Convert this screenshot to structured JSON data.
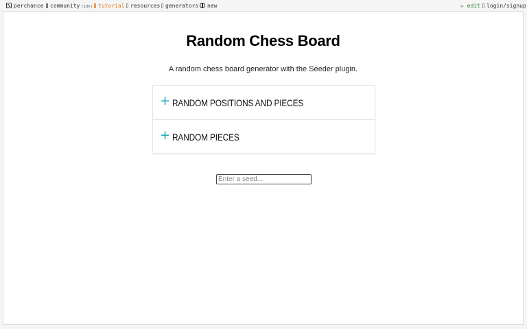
{
  "topbar": {
    "brand": "perchance",
    "community": "community",
    "community_count": "(10h)",
    "tutorial": "tutorial",
    "resources": "resources",
    "generators": "generators",
    "new": "new",
    "edit": "✏ edit",
    "login": "login/signup"
  },
  "page": {
    "title": "Random Chess Board",
    "subtitle": "A random chess board generator with the Seeder plugin."
  },
  "accordion": {
    "items": [
      {
        "icon": "+",
        "label": "RANDOM POSITIONS AND PIECES"
      },
      {
        "icon": "+",
        "label": "RANDOM PIECES"
      }
    ]
  },
  "seed": {
    "placeholder": "Enter a seed..."
  },
  "colors": {
    "accent": "#1aa3b5",
    "tutorial": "#e8771a",
    "edit": "#2a8a2a"
  }
}
